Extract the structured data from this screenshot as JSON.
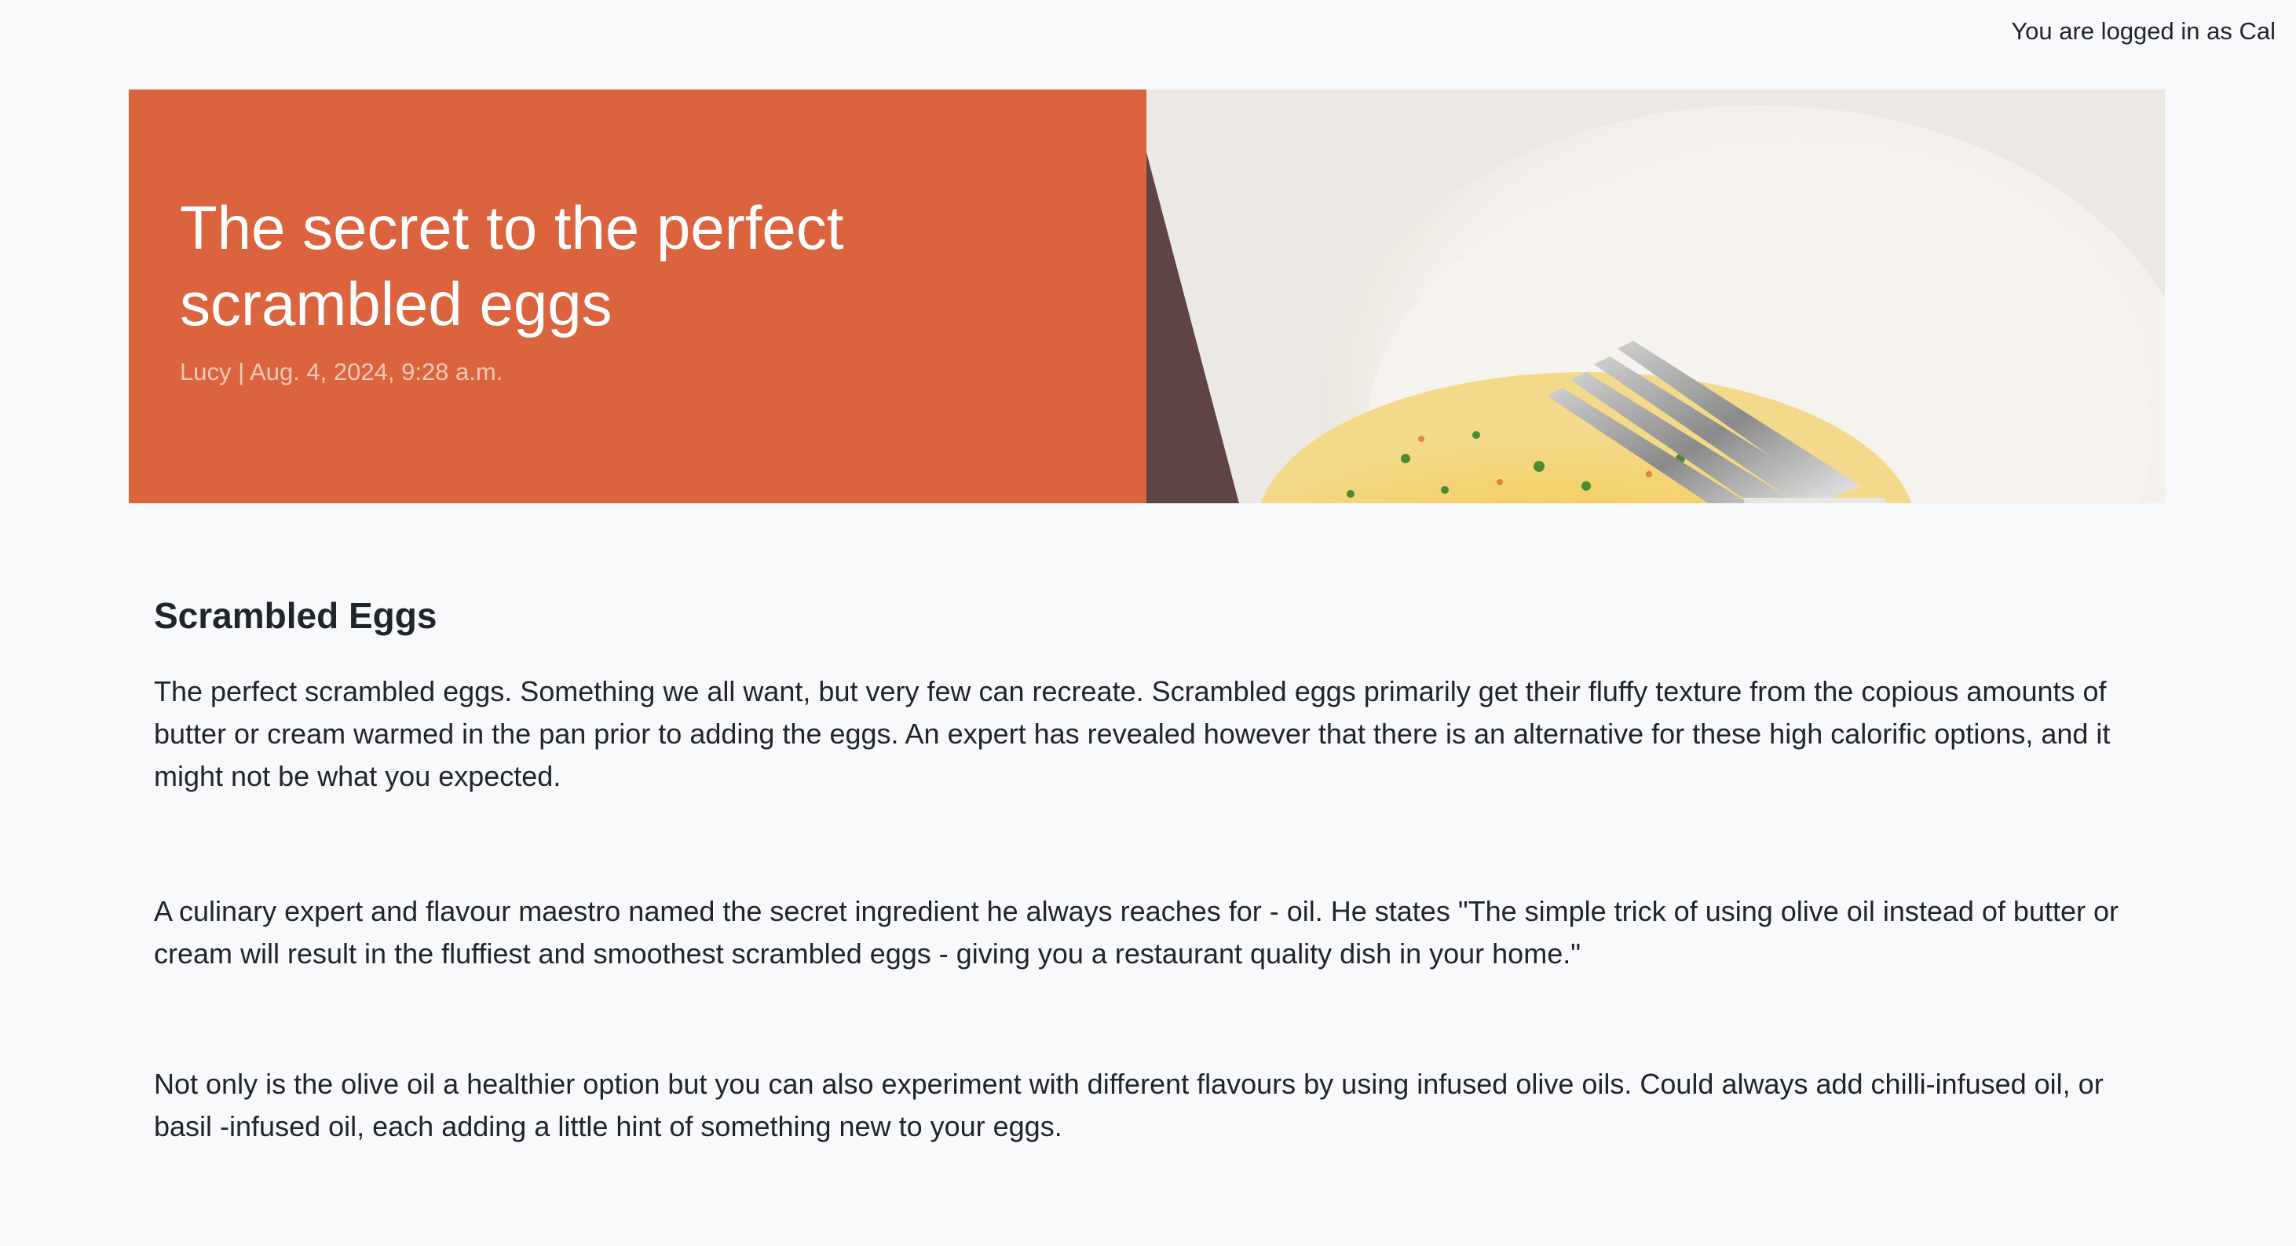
{
  "header": {
    "login_status": "You are logged in as Cal"
  },
  "hero": {
    "title": "The secret to the perfect scrambled eggs",
    "meta": "Lucy | Aug. 4, 2024, 9:28 a.m.",
    "accent_color": "#db643f",
    "image_subject": "scrambled-eggs-with-fork-photo"
  },
  "article": {
    "heading": "Scrambled Eggs",
    "paragraphs": [
      "The perfect scrambled eggs. Something we all want, but very few can recreate. Scrambled eggs primarily get their fluffy texture from the copious amounts of butter or cream warmed in the pan prior to adding the eggs. An expert has revealed however that there is an alternative for these high calorific options, and it might not be what you expected.",
      "A culinary expert and flavour maestro named the secret ingredient he always reaches for - oil. He states \"The simple trick of using olive oil instead of butter or cream will result in the fluffiest and smoothest scrambled eggs - giving you a restaurant quality dish in your home.\"",
      "Not only is the olive oil a healthier option but you can also experiment with different flavours by using infused olive oils. Could always add chilli-infused oil, or basil -infused oil, each adding a little hint of something new to your eggs."
    ]
  }
}
